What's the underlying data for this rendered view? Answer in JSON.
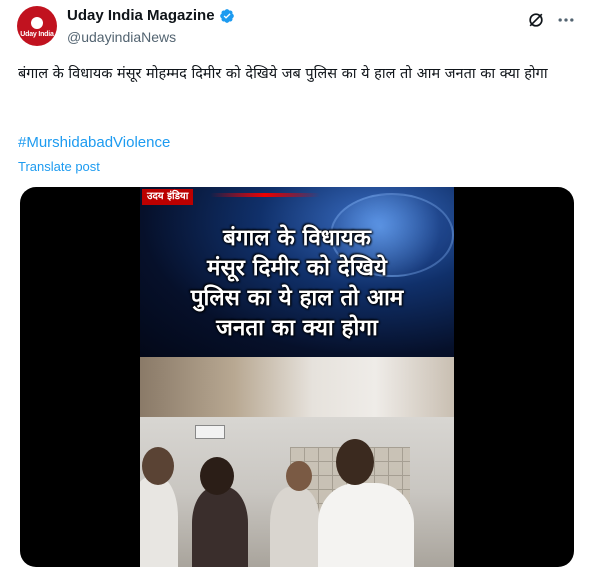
{
  "author": {
    "display_name": "Uday India Magazine",
    "handle": "@udayindiaNews",
    "avatar_label": "Uday India",
    "verified": true,
    "verified_color": "#1d9bf0"
  },
  "post": {
    "text": "बंगाल के विधायक मंसूर मोहम्मद दिमीर को देखिये जब पुलिस का ये हाल तो आम जनता का क्या होगा",
    "hashtag": "#MurshidabadViolence",
    "translate_label": "Translate post"
  },
  "media": {
    "channel_logo": "उदय इंडिया",
    "headline_lines": [
      "बंगाल के विधायक",
      "मंसूर दिमीर को देखिये",
      "पुलिस का ये हाल तो आम",
      "जनता का क्या होगा"
    ]
  },
  "icons": {
    "grok": "grok-icon",
    "more": "more-options-icon"
  },
  "colors": {
    "link": "#1d9bf0",
    "text": "#0f1419",
    "secondary": "#536471",
    "avatar_bg": "#c1121f"
  }
}
